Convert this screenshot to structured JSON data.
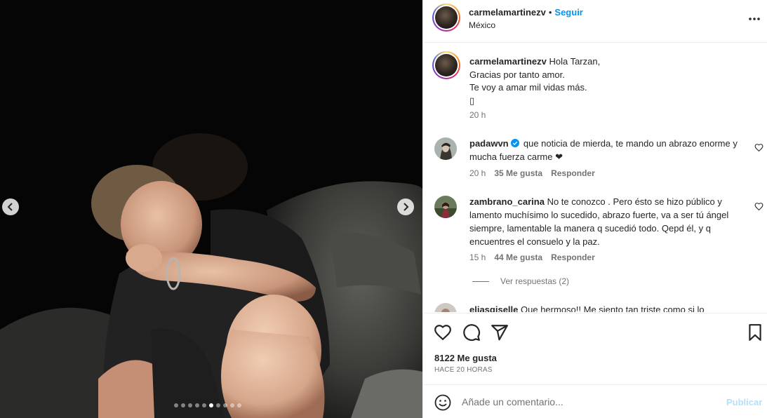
{
  "post": {
    "username": "carmelamartinezv",
    "follow_label": "Seguir",
    "separator": "•",
    "location": "México",
    "more_icon": "more-horizontal-icon",
    "carousel": {
      "slide_count": 10,
      "active_index": 5
    }
  },
  "caption": {
    "username": "carmelamartinezv",
    "lines": [
      "Hola Tarzan,",
      "Gracias por tanto amor.",
      "Te voy a amar mil vidas más.",
      "▯"
    ],
    "time": "20 h"
  },
  "comments": [
    {
      "username": "padawvn",
      "verified": true,
      "text": "que noticia de mierda, te mando un abrazo enorme y mucha fuerza carme ❤",
      "time": "20 h",
      "likes": "35 Me gusta",
      "reply_label": "Responder"
    },
    {
      "username": "zambrano_carina",
      "verified": false,
      "text": "No te conozco . Pero ésto se hizo público y lamento muchísimo lo sucedido, abrazo fuerte, va a ser tú ángel siempre, lamentable la manera q sucedió todo. Qepd él, y q encuentres el consuelo y la paz.",
      "time": "15 h",
      "likes": "44 Me gusta",
      "reply_label": "Responder"
    }
  ],
  "view_replies": "Ver respuestas (2)",
  "partial_comment": {
    "username": "eliasgiselle",
    "text": "Que hermoso!! Me siento tan triste como si lo"
  },
  "actions": {
    "like_icon": "heart-icon",
    "comment_icon": "comment-icon",
    "share_icon": "send-icon",
    "save_icon": "bookmark-icon"
  },
  "likes_count": "8122 Me gusta",
  "time_ago": "HACE 20 HORAS",
  "composer": {
    "placeholder": "Añade un comentario...",
    "post_label": "Publicar"
  },
  "colors": {
    "link": "#0095f6",
    "post_disabled": "#b2dffc",
    "secondary_text": "#737373",
    "border": "#efefef"
  }
}
